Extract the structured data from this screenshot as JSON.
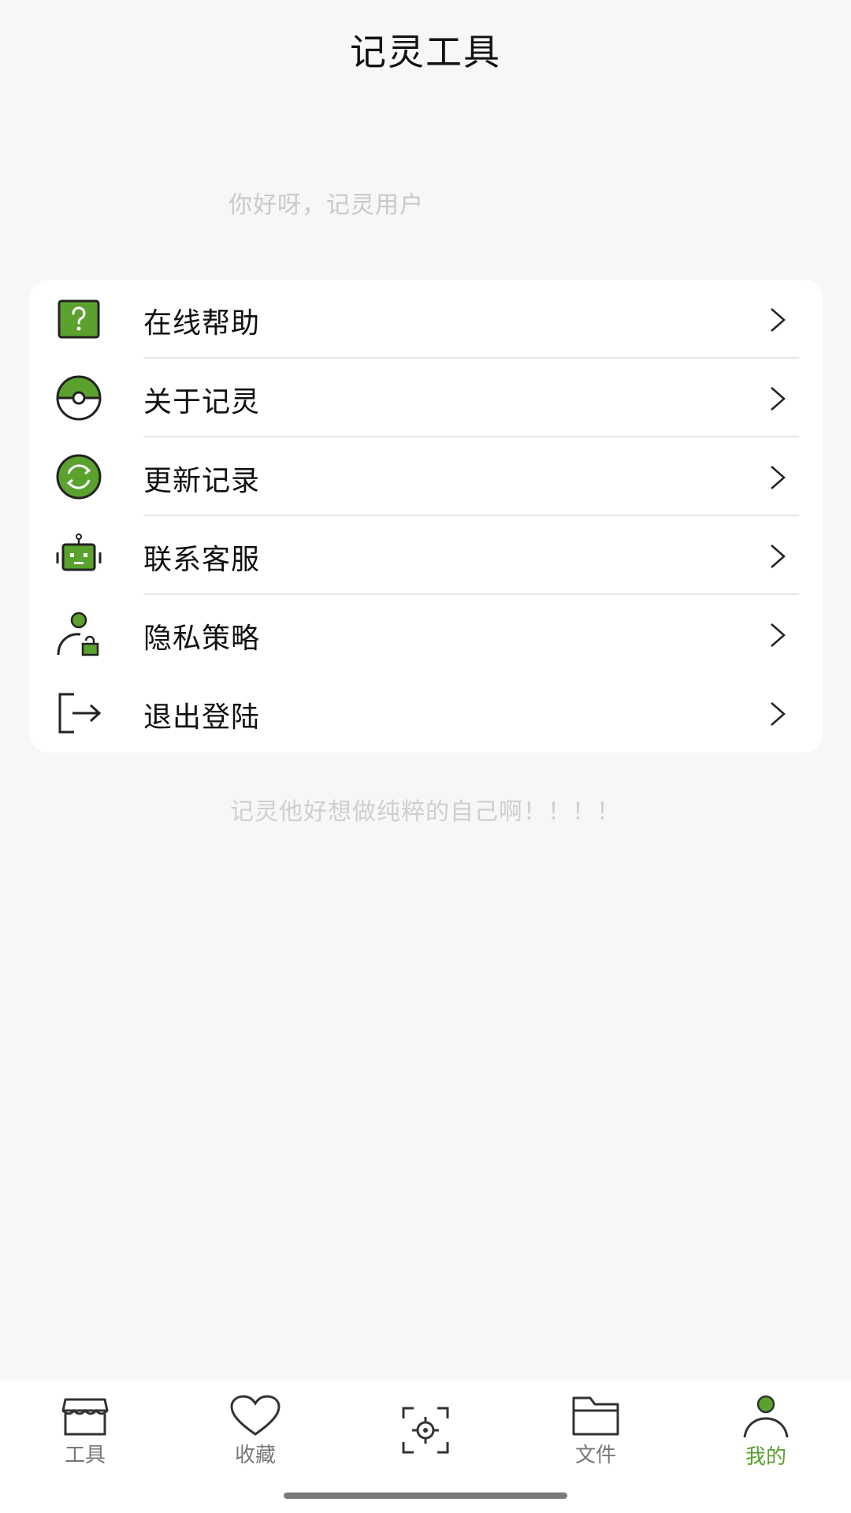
{
  "header": {
    "title": "记灵工具"
  },
  "greeting": "你好呀，记灵用户",
  "menu": [
    {
      "label": "在线帮助",
      "icon": "help-icon"
    },
    {
      "label": "关于记灵",
      "icon": "pokeball-icon"
    },
    {
      "label": "更新记录",
      "icon": "refresh-icon"
    },
    {
      "label": "联系客服",
      "icon": "robot-icon"
    },
    {
      "label": "隐私策略",
      "icon": "user-lock-icon"
    },
    {
      "label": "退出登陆",
      "icon": "logout-icon"
    }
  ],
  "footnote": "记灵他好想做纯粹的自己啊！！！！",
  "tabs": [
    {
      "label": "工具",
      "icon": "store-icon"
    },
    {
      "label": "收藏",
      "icon": "heart-icon"
    },
    {
      "label": "",
      "icon": "scan-icon"
    },
    {
      "label": "文件",
      "icon": "folder-icon"
    },
    {
      "label": "我的",
      "icon": "person-icon"
    }
  ],
  "colors": {
    "accent": "#5aa12e",
    "background": "#f7f7f7"
  }
}
